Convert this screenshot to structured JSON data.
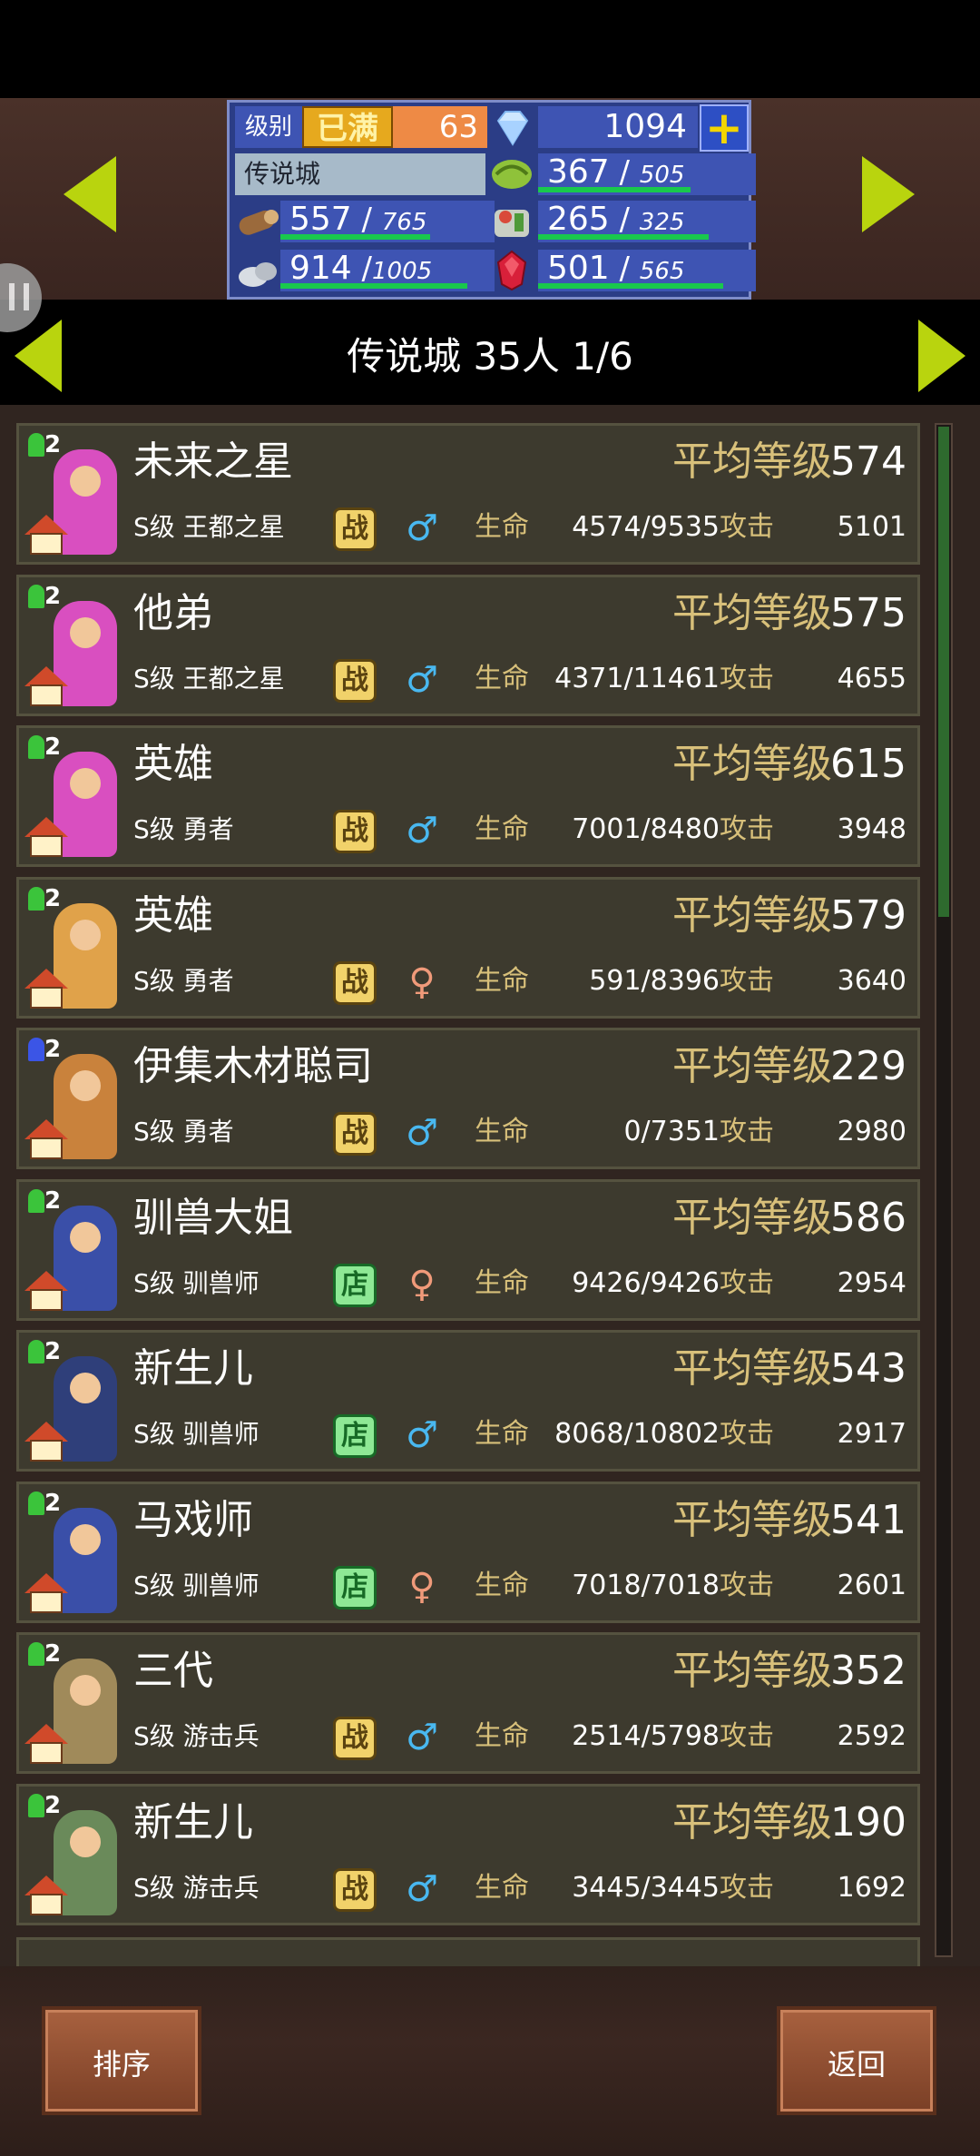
{
  "header": {
    "level_label": "级别",
    "level_max": "已满",
    "level_value": "63",
    "gems": "1094",
    "plus_label": "+",
    "city_name": "传说城",
    "resources": [
      {
        "icon": "grass-icon",
        "current": "367",
        "max": "505",
        "fill": 0.73
      },
      {
        "icon": "wood-icon",
        "current": "557",
        "max": "765",
        "fill": 0.73
      },
      {
        "icon": "food-icon",
        "current": "265",
        "max": "325",
        "fill": 0.82
      },
      {
        "icon": "stone-icon",
        "current": "914",
        "max": "1005",
        "fill": 0.91
      },
      {
        "icon": "ruby-icon",
        "current": "501",
        "max": "565",
        "fill": 0.89
      }
    ]
  },
  "subheader": {
    "title": "传说城  35人 1/6"
  },
  "labels": {
    "avg_level": "平均等级",
    "hp": "生命",
    "attack": "攻击"
  },
  "members": [
    {
      "name": "未来之星",
      "avg_level": "574",
      "class": "S级 王都之星",
      "role": "战",
      "role_type": "zhan",
      "gender": "male",
      "hp": "4574/9535",
      "attack": "5101",
      "badge_color": "#3bc43b",
      "char_color": "#d94fc0"
    },
    {
      "name": "他弟",
      "avg_level": "575",
      "class": "S级 王都之星",
      "role": "战",
      "role_type": "zhan",
      "gender": "male",
      "hp": "4371/11461",
      "attack": "4655",
      "badge_color": "#3bc43b",
      "char_color": "#d94fc0"
    },
    {
      "name": "英雄",
      "avg_level": "615",
      "class": "S级 勇者",
      "role": "战",
      "role_type": "zhan",
      "gender": "male",
      "hp": "7001/8480",
      "attack": "3948",
      "badge_color": "#3bc43b",
      "char_color": "#d94fc0"
    },
    {
      "name": "英雄",
      "avg_level": "579",
      "class": "S级 勇者",
      "role": "战",
      "role_type": "zhan",
      "gender": "female",
      "hp": "591/8396",
      "attack": "3640",
      "badge_color": "#3bc43b",
      "char_color": "#e0a24a"
    },
    {
      "name": "伊集木材聪司",
      "avg_level": "229",
      "class": "S级 勇者",
      "role": "战",
      "role_type": "zhan",
      "gender": "male",
      "hp": "0/7351",
      "attack": "2980",
      "badge_color": "#3b55e6",
      "char_color": "#c9823c"
    },
    {
      "name": "驯兽大姐",
      "avg_level": "586",
      "class": "S级 驯兽师",
      "role": "店",
      "role_type": "dian",
      "gender": "female",
      "hp": "9426/9426",
      "attack": "2954",
      "badge_color": "#3bc43b",
      "char_color": "#3a4fa8"
    },
    {
      "name": "新生儿",
      "avg_level": "543",
      "class": "S级 驯兽师",
      "role": "店",
      "role_type": "dian",
      "gender": "male",
      "hp": "8068/10802",
      "attack": "2917",
      "badge_color": "#3bc43b",
      "char_color": "#2f3f7a"
    },
    {
      "name": "马戏师",
      "avg_level": "541",
      "class": "S级 驯兽师",
      "role": "店",
      "role_type": "dian",
      "gender": "female",
      "hp": "7018/7018",
      "attack": "2601",
      "badge_color": "#3bc43b",
      "char_color": "#3a4fa8"
    },
    {
      "name": "三代",
      "avg_level": "352",
      "class": "S级 游击兵",
      "role": "战",
      "role_type": "zhan",
      "gender": "male",
      "hp": "2514/5798",
      "attack": "2592",
      "badge_color": "#3bc43b",
      "char_color": "#a08a5a"
    },
    {
      "name": "新生儿",
      "avg_level": "190",
      "class": "S级 游击兵",
      "role": "战",
      "role_type": "zhan",
      "gender": "male",
      "hp": "3445/3445",
      "attack": "1692",
      "badge_color": "#3bc43b",
      "char_color": "#6a8a5a"
    }
  ],
  "footer": {
    "sort_label": "排序",
    "back_label": "返回"
  }
}
